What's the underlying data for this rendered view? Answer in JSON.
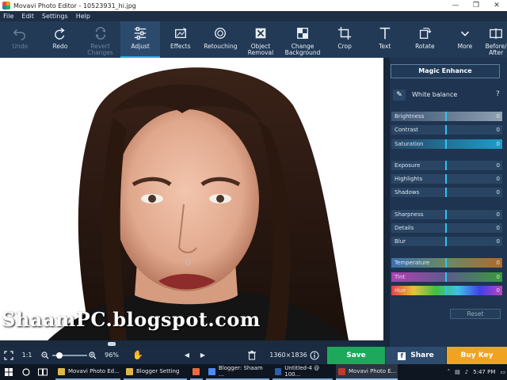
{
  "window": {
    "title": "Movavi Photo Editor - 10523931_hi.jpg",
    "controls": [
      "—",
      "❐",
      "✕"
    ]
  },
  "menu": [
    "File",
    "Edit",
    "Settings",
    "Help"
  ],
  "toolbar": [
    {
      "label": "Undo",
      "icon": "undo-icon",
      "enabled": false
    },
    {
      "label": "Redo",
      "icon": "redo-icon",
      "enabled": true
    },
    {
      "label": "Revert\nChanges",
      "icon": "revert-icon",
      "enabled": false
    },
    {
      "label": "Adjust",
      "icon": "sliders-icon",
      "enabled": true,
      "active": true
    },
    {
      "label": "Effects",
      "icon": "effects-icon",
      "enabled": true
    },
    {
      "label": "Retouching",
      "icon": "retouch-icon",
      "enabled": true
    },
    {
      "label": "Object\nRemoval",
      "icon": "eraser-icon",
      "enabled": true
    },
    {
      "label": "Change\nBackground",
      "icon": "background-icon",
      "enabled": true
    },
    {
      "label": "Crop",
      "icon": "crop-icon",
      "enabled": true
    },
    {
      "label": "Text",
      "icon": "text-icon",
      "enabled": true
    },
    {
      "label": "Rotate",
      "icon": "rotate-icon",
      "enabled": true
    },
    {
      "label": "More",
      "icon": "chevron-down-icon",
      "enabled": true
    },
    {
      "label": "Before/\nAfter",
      "icon": "before-after-icon",
      "enabled": true
    }
  ],
  "watermark": "ShaamPC.blogspot.com",
  "panel": {
    "magic_label": "Magic Enhance",
    "white_balance_label": "White balance",
    "help": "?",
    "reset_label": "Reset",
    "sliders": [
      {
        "label": "Brightness",
        "value": "0",
        "style": "gray"
      },
      {
        "label": "Contrast",
        "value": "0",
        "style": "plain"
      },
      {
        "label": "Saturation",
        "value": "0",
        "style": "teal"
      },
      {
        "label": "Exposure",
        "value": "0",
        "style": "plain"
      },
      {
        "label": "Highlights",
        "value": "0",
        "style": "plain"
      },
      {
        "label": "Shadows",
        "value": "0",
        "style": "plain"
      },
      {
        "label": "Sharpness",
        "value": "0",
        "style": "plain"
      },
      {
        "label": "Details",
        "value": "0",
        "style": "plain"
      },
      {
        "label": "Blur",
        "value": "0",
        "style": "plain"
      },
      {
        "label": "Temperature",
        "value": "0",
        "style": "temperature"
      },
      {
        "label": "Tint",
        "value": "0",
        "style": "tint"
      },
      {
        "label": "Hue",
        "value": "0",
        "style": "hue"
      }
    ]
  },
  "bottombar": {
    "fit_icon": "fit-screen-icon",
    "one_to_one": "1:1",
    "zoom": "96%",
    "dimensions": "1360×1836",
    "save_label": "Save",
    "share_label": "Share",
    "buy_label": "Buy Key"
  },
  "taskbar": {
    "apps": [
      {
        "label": "Movavi Photo Ed...",
        "color": "#e0b84a",
        "state": "open"
      },
      {
        "label": "Blogger Setting",
        "color": "#e0b84a",
        "state": "open"
      },
      {
        "label": "",
        "color": "#f06a3c",
        "state": "open"
      },
      {
        "label": "Blogger: Shaam ...",
        "color": "#4c8bf5",
        "state": "open"
      },
      {
        "label": "Untitled-4 @ 100...",
        "color": "#2b5fa8",
        "state": "open"
      },
      {
        "label": "Movavi Photo E...",
        "color": "#c0392b",
        "state": "current"
      }
    ],
    "time": "5:47 PM"
  },
  "colors": {
    "accent": "#2fa9e0",
    "save": "#1ea85b",
    "buy": "#f0a221",
    "panel": "#1e3450"
  }
}
